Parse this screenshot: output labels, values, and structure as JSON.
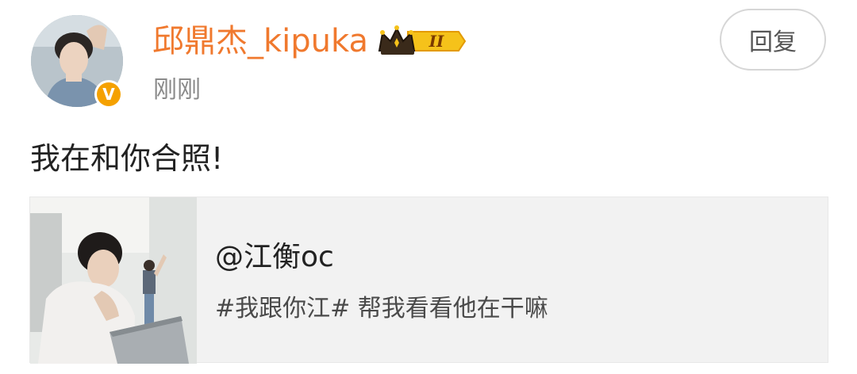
{
  "post": {
    "author": {
      "name": "邱鼎杰_kipuka",
      "verified_icon": "verified-v-icon",
      "vip_badge_icon": "crown-vip-icon",
      "vip_level": "II"
    },
    "timestamp": "刚刚",
    "reply_label": "回复",
    "text": "我在和你合照!",
    "linked_card": {
      "title": "@江衡oc",
      "description": "#我跟你江# 帮我看看他在干嘛",
      "thumbnail_icon": "photo-thumbnail"
    }
  },
  "colors": {
    "username": "#f0792e",
    "badge_gold": "#f5a100",
    "card_bg": "#f2f2f2",
    "timestamp": "#8a8a8a"
  }
}
